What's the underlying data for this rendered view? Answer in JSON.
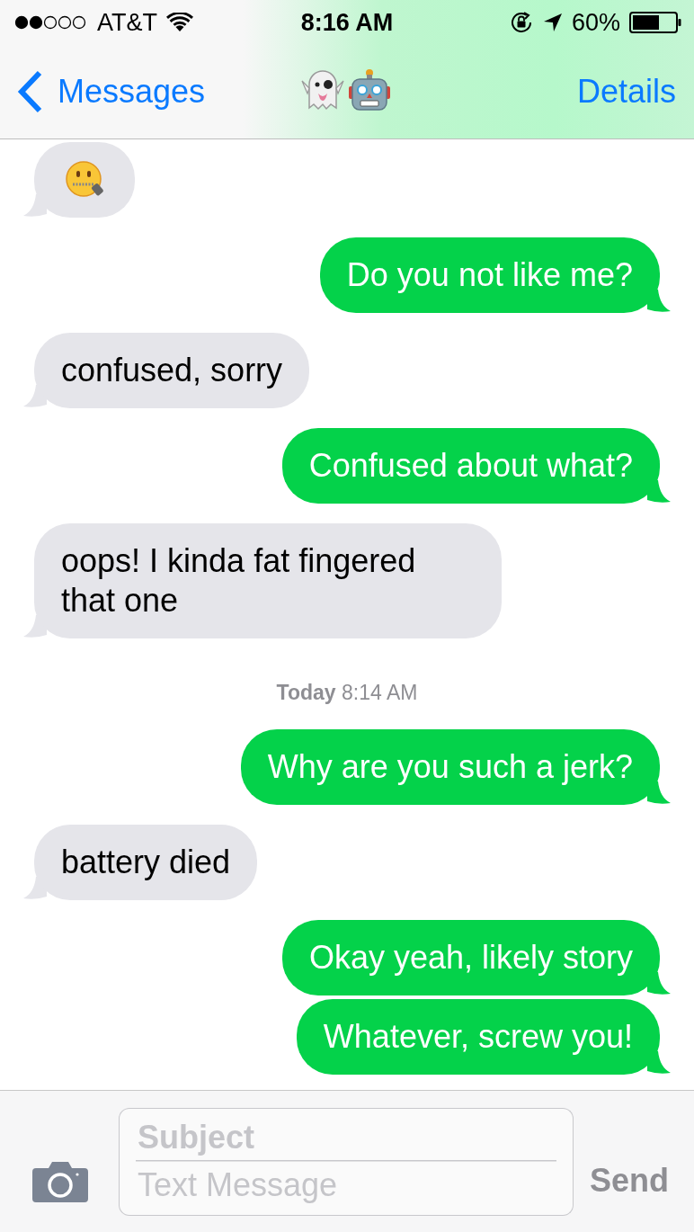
{
  "status_bar": {
    "carrier": "AT&T",
    "time": "8:16 AM",
    "battery": "60%"
  },
  "nav": {
    "back": "Messages",
    "action": "Details"
  },
  "messages": [
    {
      "kind": "emoji"
    },
    {
      "kind": "sent",
      "text": "Do you not like me?"
    },
    {
      "kind": "received",
      "text": "confused, sorry"
    },
    {
      "kind": "sent",
      "text": "Confused about what?"
    },
    {
      "kind": "received",
      "text": "oops! I kinda fat fingered that one"
    },
    {
      "kind": "timestamp",
      "text": "**Today** 8:14 AM"
    },
    {
      "kind": "sent",
      "text": "Why are you such a jerk?"
    },
    {
      "kind": "received",
      "text": "battery died"
    },
    {
      "kind": "sent",
      "text": "Okay yeah, likely story"
    },
    {
      "kind": "sent",
      "text": "Whatever, screw you!"
    }
  ],
  "composer": {
    "subject_placeholder": "Subject",
    "message_placeholder": "Text Message",
    "send": "Send",
    "send_disabled": true
  }
}
